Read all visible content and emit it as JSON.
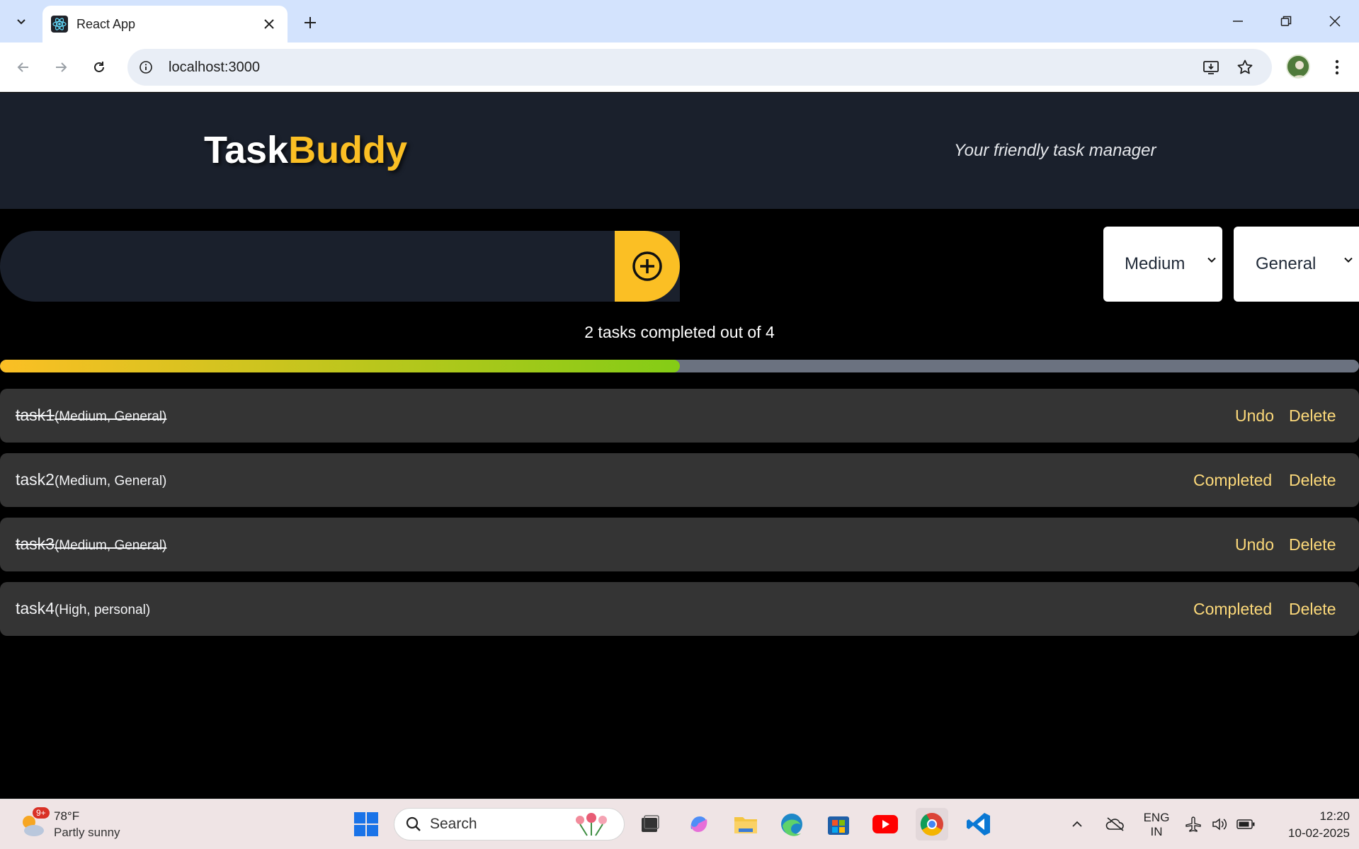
{
  "browser": {
    "tab_title": "React App",
    "url": "localhost:3000"
  },
  "app": {
    "logo_part1": "Task",
    "logo_part2": "Buddy",
    "tagline": "Your friendly task manager",
    "input_value": "",
    "priority_select": "Medium",
    "category_select": "General",
    "progress_text": "2 tasks completed out of 4",
    "progress_fraction": 0.5,
    "tasks": [
      {
        "name": "task1",
        "meta": "(Medium, General)",
        "completed": true,
        "toggle_label": "Undo",
        "delete_label": "Delete"
      },
      {
        "name": "task2",
        "meta": "(Medium, General)",
        "completed": false,
        "toggle_label": "Completed",
        "delete_label": "Delete"
      },
      {
        "name": "task3",
        "meta": "(Medium, General)",
        "completed": true,
        "toggle_label": "Undo",
        "delete_label": "Delete"
      },
      {
        "name": "task4",
        "meta": "(High, personal)",
        "completed": false,
        "toggle_label": "Completed",
        "delete_label": "Delete"
      }
    ],
    "colors": {
      "accent": "#fbbf24",
      "header_bg": "#1a202c",
      "task_bg": "#343434",
      "action_text": "#fcd97a"
    }
  },
  "taskbar": {
    "weather_badge": "9+",
    "weather_temp": "78°F",
    "weather_desc": "Partly sunny",
    "search_placeholder": "Search",
    "lang_line1": "ENG",
    "lang_line2": "IN",
    "time": "12:20",
    "date": "10-02-2025"
  }
}
